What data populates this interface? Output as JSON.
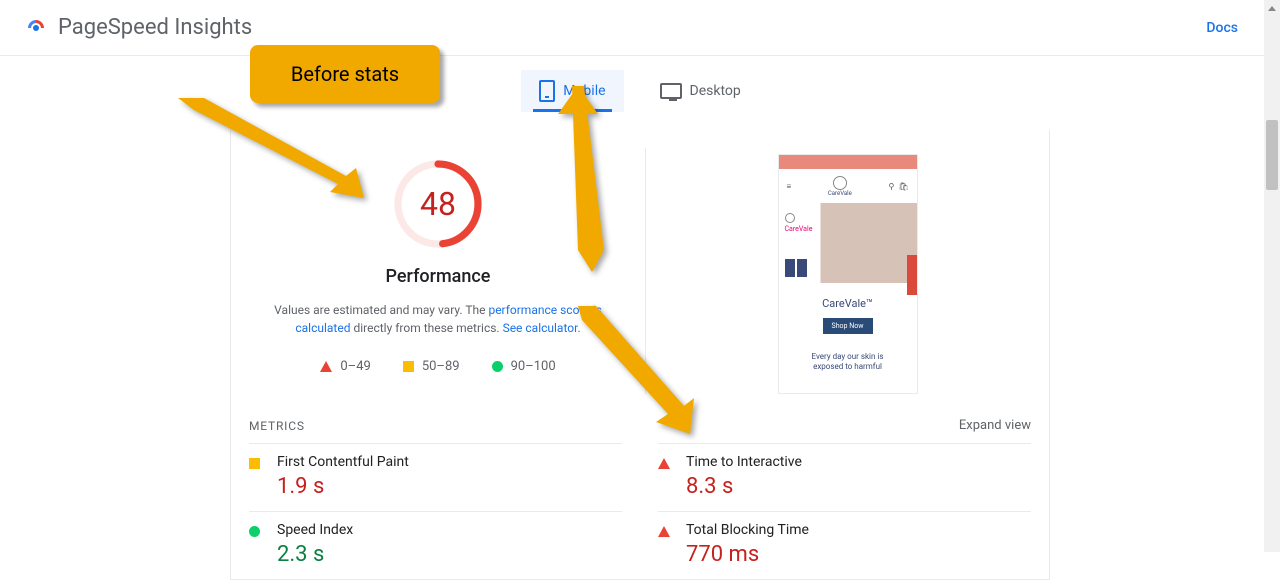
{
  "header": {
    "app_title": "PageSpeed Insights",
    "docs_label": "Docs"
  },
  "annotation": {
    "callout": "Before stats"
  },
  "tabs": {
    "mobile": "Mobile",
    "desktop": "Desktop"
  },
  "performance": {
    "score": "48",
    "label": "Performance",
    "desc_prefix": "Values are estimated and may vary. The ",
    "desc_link1": "performance score is calculated",
    "desc_mid": " directly from these metrics. ",
    "desc_link2": "See calculator",
    "desc_suffix": ".",
    "legend": {
      "poor": "0–49",
      "mid": "50–89",
      "good": "90–100"
    }
  },
  "preview": {
    "brand": "CareVale",
    "name": "CareVale™",
    "cta": "Shop Now",
    "tag1": "Every day our skin is",
    "tag2": "exposed to harmful"
  },
  "metrics_header": {
    "title": "METRICS",
    "expand": "Expand view"
  },
  "metrics": {
    "fcp_name": "First Contentful Paint",
    "fcp_value": "1.9 s",
    "si_name": "Speed Index",
    "si_value": "2.3 s",
    "tti_name": "Time to Interactive",
    "tti_value": "8.3 s",
    "tbt_name": "Total Blocking Time",
    "tbt_value": "770 ms"
  }
}
